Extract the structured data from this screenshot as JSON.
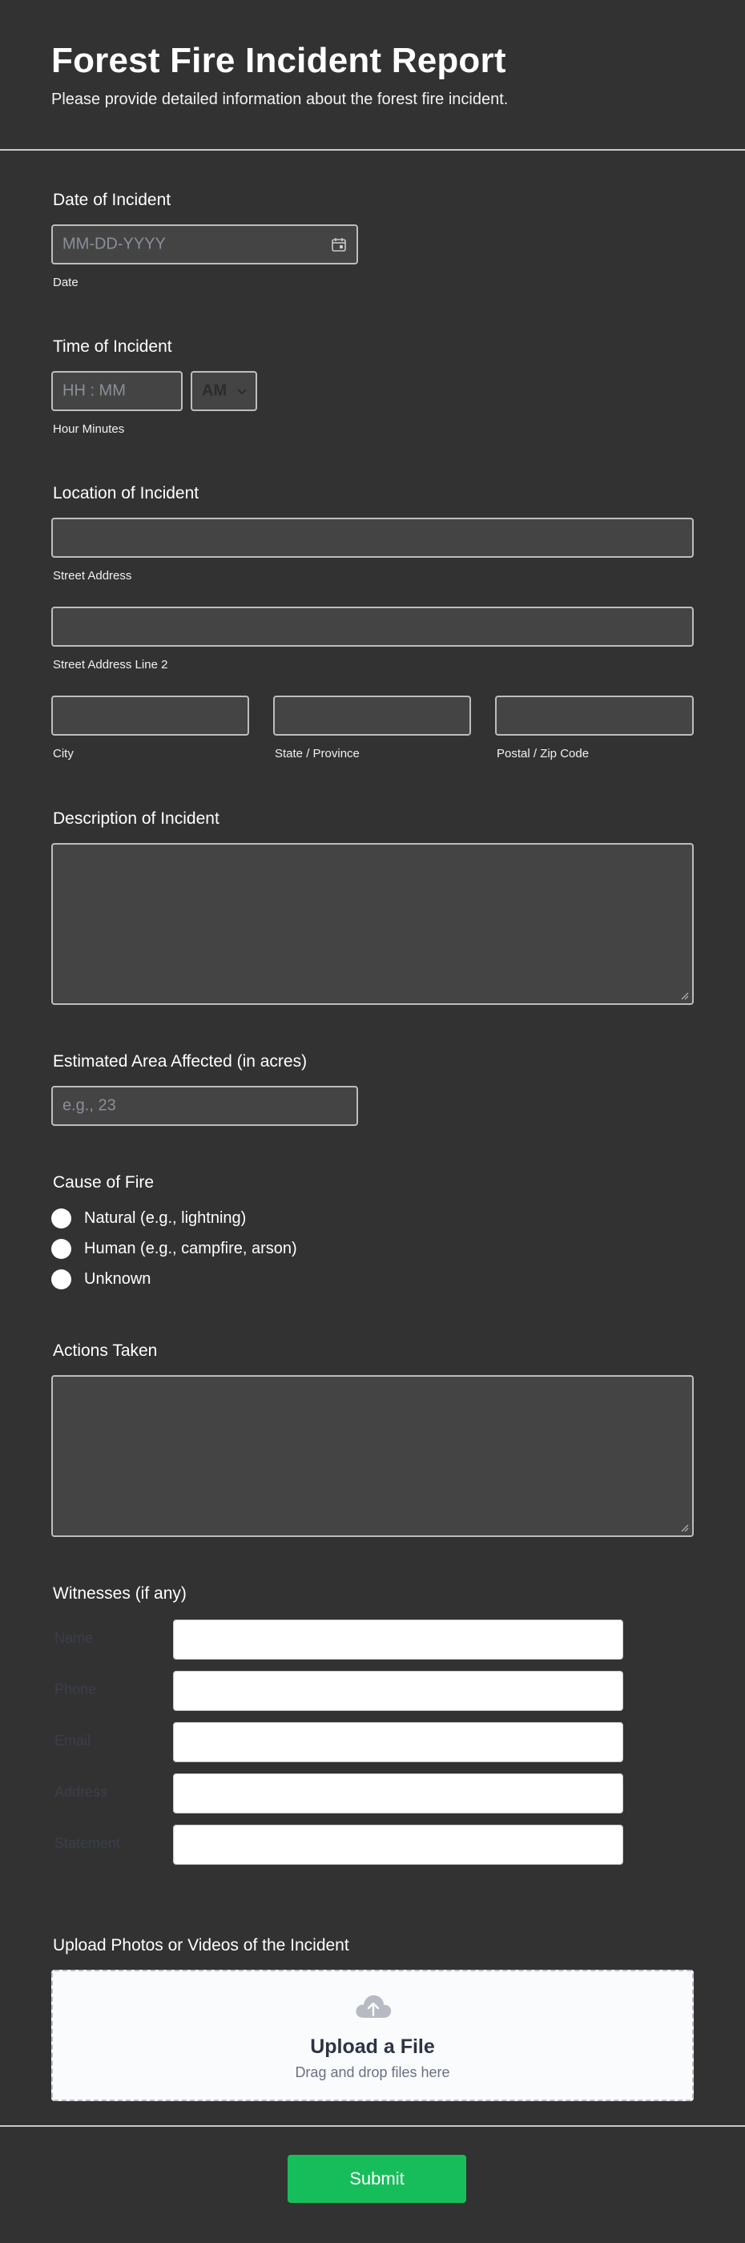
{
  "header": {
    "title": "Forest Fire Incident Report",
    "subtitle": "Please provide detailed information about the forest fire incident."
  },
  "date": {
    "label": "Date of Incident",
    "placeholder": "MM-DD-YYYY",
    "sublabel": "Date",
    "icon": "calendar-icon"
  },
  "time": {
    "label": "Time of Incident",
    "placeholder": "HH : MM",
    "ampm": "AM",
    "sublabel": "Hour Minutes"
  },
  "location": {
    "label": "Location of Incident",
    "street": "Street Address",
    "street2": "Street Address Line 2",
    "city": "City",
    "state": "State / Province",
    "zip": "Postal / Zip Code"
  },
  "description": {
    "label": "Description of Incident"
  },
  "area": {
    "label": "Estimated Area Affected (in acres)",
    "placeholder": "e.g., 23"
  },
  "cause": {
    "label": "Cause of Fire",
    "options": [
      "Natural (e.g., lightning)",
      "Human (e.g., campfire, arson)",
      "Unknown"
    ]
  },
  "actions": {
    "label": "Actions Taken"
  },
  "witnesses": {
    "label": "Witnesses (if any)",
    "rows": [
      "Name",
      "Phone",
      "Email",
      "Address",
      "Statement"
    ]
  },
  "upload": {
    "label": "Upload Photos or Videos of the Incident",
    "title": "Upload a File",
    "subtitle": "Drag and drop files here",
    "icon": "cloud-upload-icon"
  },
  "submit": {
    "label": "Submit",
    "color": "#18bd5b"
  },
  "colors": {
    "background": "#323232",
    "field": "#444444",
    "accent": "#18bd5b"
  }
}
